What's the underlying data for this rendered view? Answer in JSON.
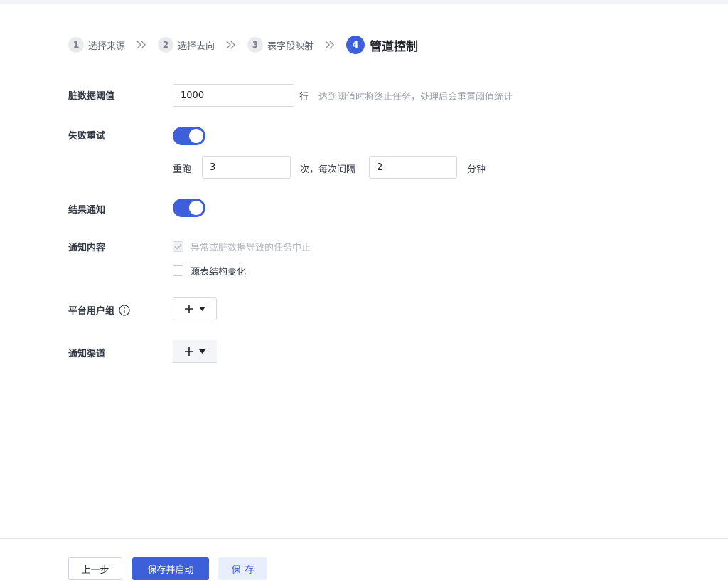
{
  "steps": [
    {
      "num": "1",
      "label": "选择来源"
    },
    {
      "num": "2",
      "label": "选择去向"
    },
    {
      "num": "3",
      "label": "表字段映射"
    },
    {
      "num": "4",
      "label": "管道控制"
    }
  ],
  "dirty_threshold": {
    "label": "脏数据阈值",
    "value": "1000",
    "unit": "行",
    "hint": "达到阈值时将终止任务，处理后会重置阈值统计"
  },
  "retry": {
    "label": "失败重试",
    "enabled": true,
    "rerun_label": "重跑",
    "count": "3",
    "interval_label": "次，每次间隔",
    "interval": "2",
    "interval_unit": "分钟"
  },
  "notify": {
    "label": "结果通知",
    "enabled": true
  },
  "notify_content": {
    "label": "通知内容",
    "options": [
      {
        "label": "异常或脏数据导致的任务中止",
        "checked": true,
        "disabled": true
      },
      {
        "label": "源表结构变化",
        "checked": false,
        "disabled": false
      }
    ]
  },
  "user_group": {
    "label": "平台用户组"
  },
  "channel": {
    "label": "通知渠道"
  },
  "footer": {
    "prev": "上一步",
    "save_start": "保存并启动",
    "save": "保存"
  },
  "colors": {
    "primary": "#3d5fd9"
  }
}
